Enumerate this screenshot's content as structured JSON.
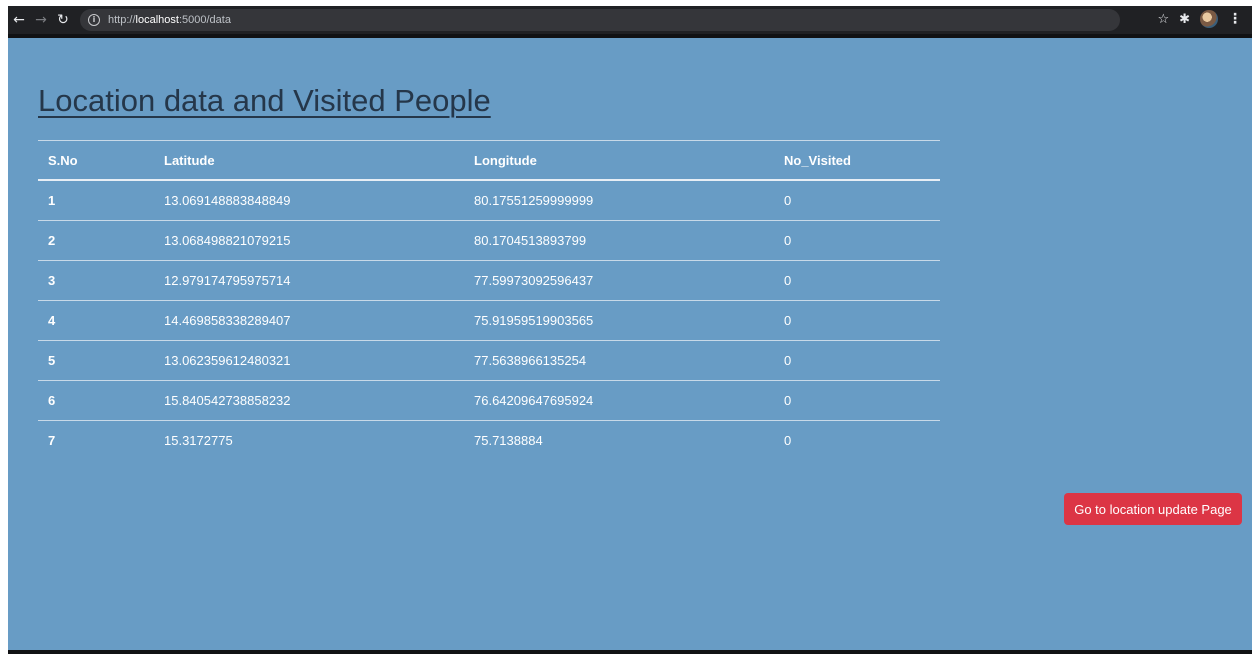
{
  "browser": {
    "url_prefix": "http://",
    "url_host": "localhost",
    "url_rest": ":5000/data",
    "icons": [
      "back-icon",
      "forward-icon",
      "reload-icon",
      "info-icon",
      "star-icon",
      "extensions-icon",
      "avatar",
      "menu-icon"
    ]
  },
  "page": {
    "title": "Location data and Visited People",
    "background": "#689cc5"
  },
  "table": {
    "headers": [
      "S.No",
      "Latitude",
      "Longitude",
      "No_Visited"
    ],
    "rows": [
      [
        "1",
        "13.069148883848849",
        "80.17551259999999",
        "0"
      ],
      [
        "2",
        "13.068498821079215",
        "80.1704513893799",
        "0"
      ],
      [
        "3",
        "12.979174795975714",
        "77.59973092596437",
        "0"
      ],
      [
        "4",
        "14.469858338289407",
        "75.91959519903565",
        "0"
      ],
      [
        "5",
        "13.062359612480321",
        "77.5638966135254",
        "0"
      ],
      [
        "6",
        "15.840542738858232",
        "76.64209647695924",
        "0"
      ],
      [
        "7",
        "15.3172775",
        "75.7138884",
        "0"
      ]
    ]
  },
  "update_button": {
    "label": "Go to location update Page",
    "color": "#dc3545"
  }
}
